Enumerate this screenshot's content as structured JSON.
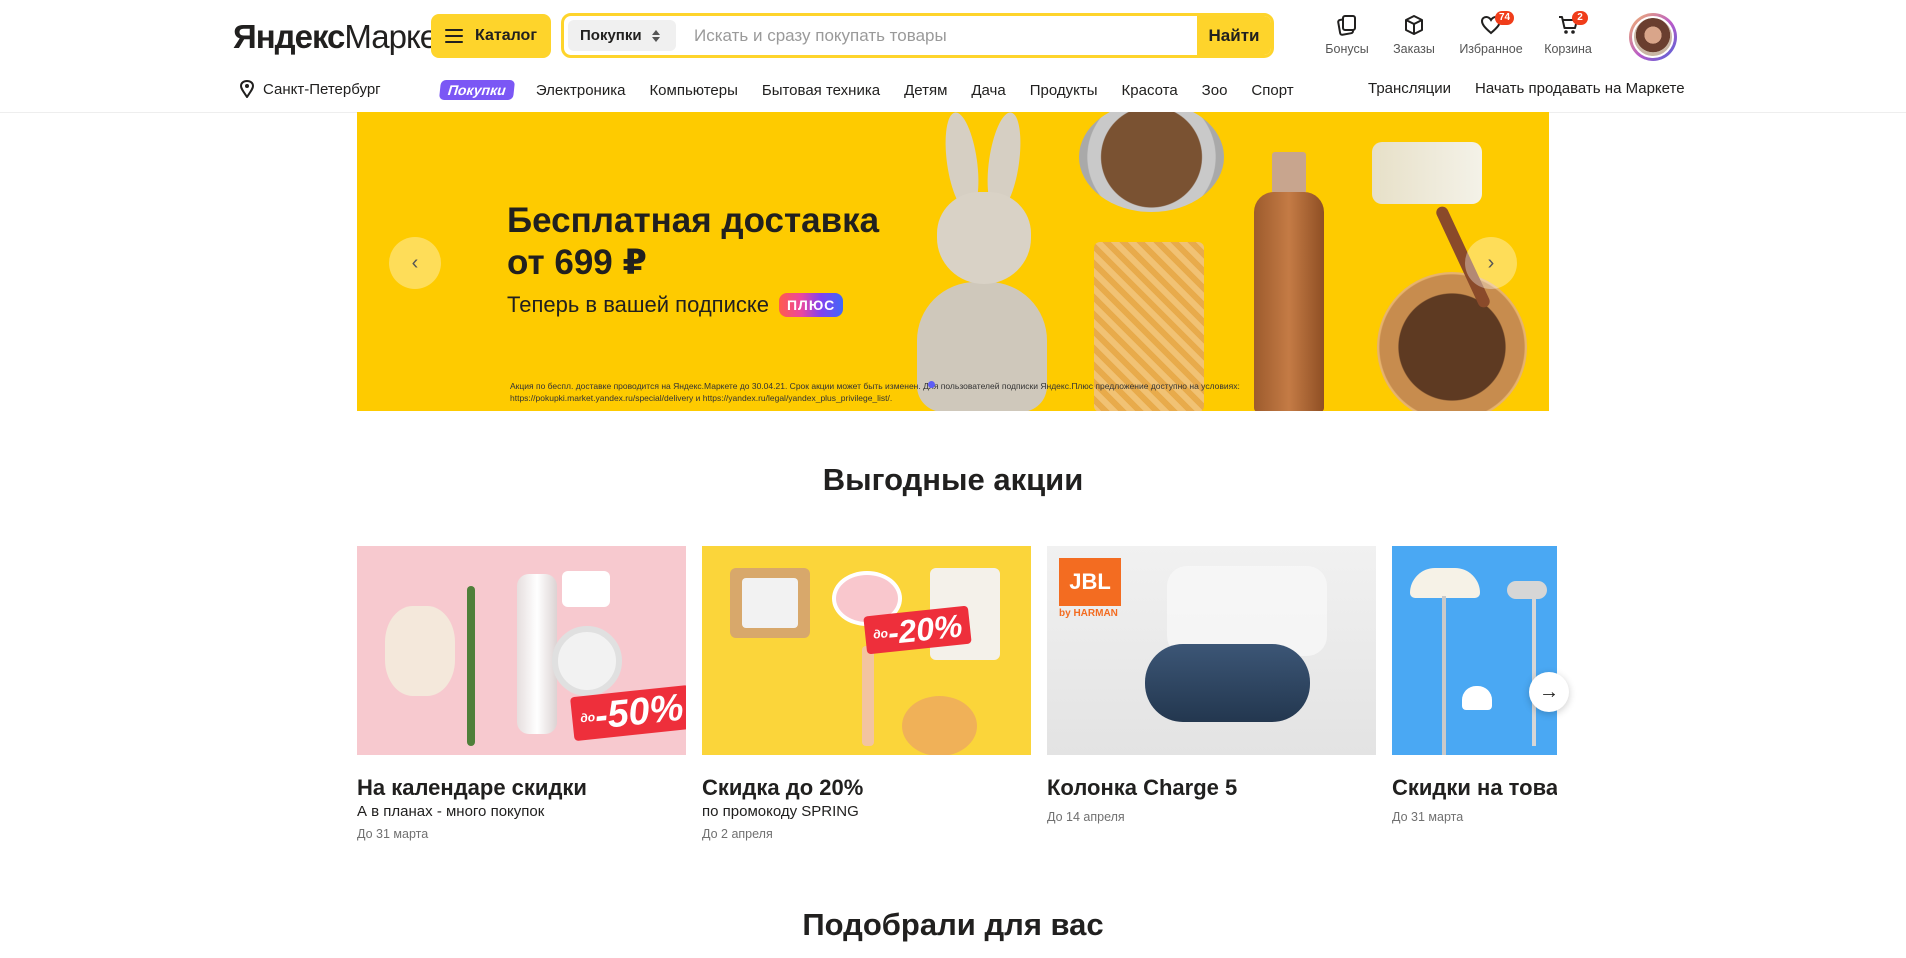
{
  "header": {
    "logo_bold": "Яндекс",
    "logo_light": "Маркет",
    "catalog_label": "Каталог",
    "search": {
      "scope_label": "Покупки",
      "placeholder": "Искать и сразу покупать товары",
      "button_label": "Найти"
    },
    "icons": [
      {
        "icon": "bonus-icon",
        "label": "Бонусы"
      },
      {
        "icon": "orders-icon",
        "label": "Заказы"
      },
      {
        "icon": "heart-icon",
        "label": "Избранное",
        "badge": "74"
      },
      {
        "icon": "cart-icon",
        "label": "Корзина",
        "badge": "2"
      }
    ],
    "city": "Санкт-Петербург",
    "nav": {
      "pill": "Покупки",
      "items": [
        "Электроника",
        "Компьютеры",
        "Бытовая техника",
        "Детям",
        "Дача",
        "Продукты",
        "Красота",
        "Зоо",
        "Спорт"
      ],
      "right": [
        "Трансляции",
        "Начать продавать на Маркете"
      ]
    }
  },
  "banner": {
    "title_line1": "Бесплатная доставка",
    "title_line2": "от 699 ₽",
    "subtitle": "Теперь в вашей подписке",
    "plus_badge": "ПЛЮС",
    "legal": "Акция по беспл. доставке проводится на Яндекс.Маркете до 30.04.21. Срок акции может быть изменен. Для пользователей подписки Яндекс.Плюс предложение доступно на условиях: https://pokupki.market.yandex.ru/special/delivery и https://yandex.ru/legal/yandex_plus_privilege_list/."
  },
  "promos": {
    "title": "Выгодные акции",
    "cards": [
      {
        "title": "На календаре скидки",
        "desc": "А в планах - много покупок",
        "date": "До 31 марта",
        "badge_prefix": "до",
        "badge": "-50%"
      },
      {
        "title": "Скидка до 20%",
        "desc": "по промокоду SPRING",
        "date": "До 2 апреля",
        "badge_prefix": "до",
        "badge": "-20%"
      },
      {
        "title": "Колонка Charge 5",
        "desc": "",
        "date": "До 14 апреля",
        "brand": "JBL",
        "brand_sub": "by HARMAN"
      },
      {
        "title": "Скидки на товары",
        "desc": "",
        "date": "До 31 марта"
      }
    ]
  },
  "recommend": {
    "title": "Подобрали для вас"
  },
  "colors": {
    "brand_yellow": "#fed42b",
    "banner_yellow": "#fecb00",
    "badge_red": "#f03d1a",
    "pill_purple": "#7b57f5"
  }
}
